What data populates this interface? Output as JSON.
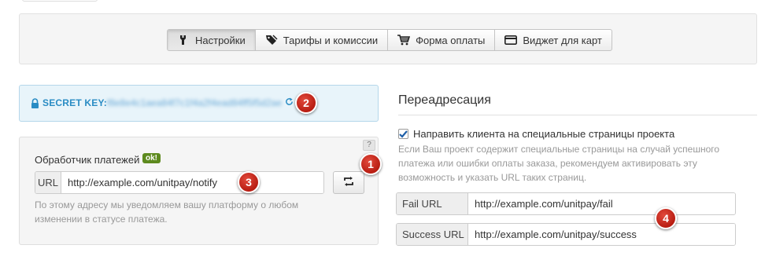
{
  "nav": {
    "tabs": [
      {
        "label": "Настройки",
        "icon": "wrench-icon",
        "active": true
      },
      {
        "label": "Тарифы и комиссии",
        "icon": "tag-icon",
        "active": false
      },
      {
        "label": "Форма оплаты",
        "icon": "cart-icon",
        "active": false
      },
      {
        "label": "Виджет для карт",
        "icon": "credit-card-icon",
        "active": false
      }
    ]
  },
  "secret": {
    "label": "SECRET KEY:",
    "value": "f8e8e4c1aea84f7c1f4a2f4ead84ff5f5d2ae",
    "icons": [
      "lock-icon",
      "refresh-icon"
    ]
  },
  "handler": {
    "title": "Обработчик платежей",
    "badge": "ok!",
    "help": "?",
    "url_label": "URL",
    "url_value": "http://example.com/unitpay/notify",
    "hint": "По этому адресу мы уведомляем вашу платформу о любом изменении в статусе платежа."
  },
  "redirect": {
    "title": "Переадресация",
    "checkbox_label": "Направить клиента на специальные страницы проекта",
    "checkbox_checked": true,
    "hint": "Если Ваш проект содержит специальные страницы на случай успешного платежа или ошибки оплаты заказа, рекомендуем активировать эту возможность и указать URL таких страниц.",
    "fail_label": "Fail URL",
    "fail_value": "http://example.com/unitpay/fail",
    "success_label": "Success URL",
    "success_value": "http://example.com/unitpay/success"
  },
  "markers": [
    "1",
    "2",
    "3",
    "4"
  ],
  "colors": {
    "accent_blue": "#2a8cc4",
    "secret_bg": "#e8f4fa",
    "ok_green": "#5d8a1e",
    "marker_red": "#c8281b"
  }
}
